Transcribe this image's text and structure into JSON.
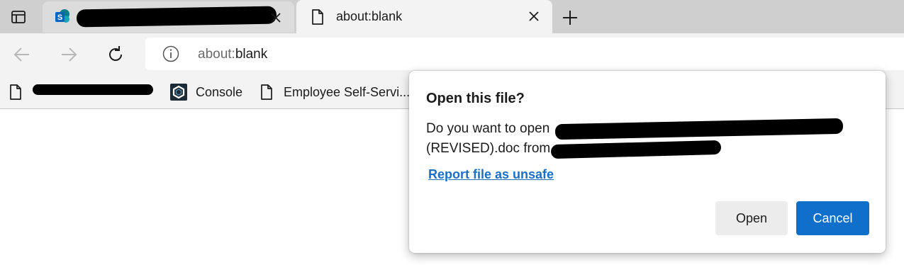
{
  "tabs": [
    {
      "title": "",
      "icon": "sharepoint-icon",
      "redacted": true
    },
    {
      "title": "about:blank",
      "icon": "page-icon",
      "active": true
    }
  ],
  "toolbar": {
    "back_icon": "back-arrow-icon",
    "forward_icon": "forward-arrow-icon",
    "refresh_icon": "refresh-icon"
  },
  "address_bar": {
    "scheme": "about:",
    "path": "blank"
  },
  "bookmarks": [
    {
      "label": "",
      "icon": "page-icon",
      "redacted": true
    },
    {
      "label": "Console",
      "icon": "console-logo-icon"
    },
    {
      "label": "Employee Self-Servi...",
      "icon": "page-icon"
    }
  ],
  "dialog": {
    "title": "Open this file?",
    "line1_prefix": "Do you want to open",
    "line2_prefix": "(REVISED).doc from",
    "report_link": "Report file as unsafe",
    "open_button": "Open",
    "cancel_button": "Cancel"
  },
  "colors": {
    "accent": "#0f6fcb",
    "link": "#1a6fc4",
    "tabstrip": "#cfcfcf",
    "toolbar": "#f3f3f3"
  }
}
